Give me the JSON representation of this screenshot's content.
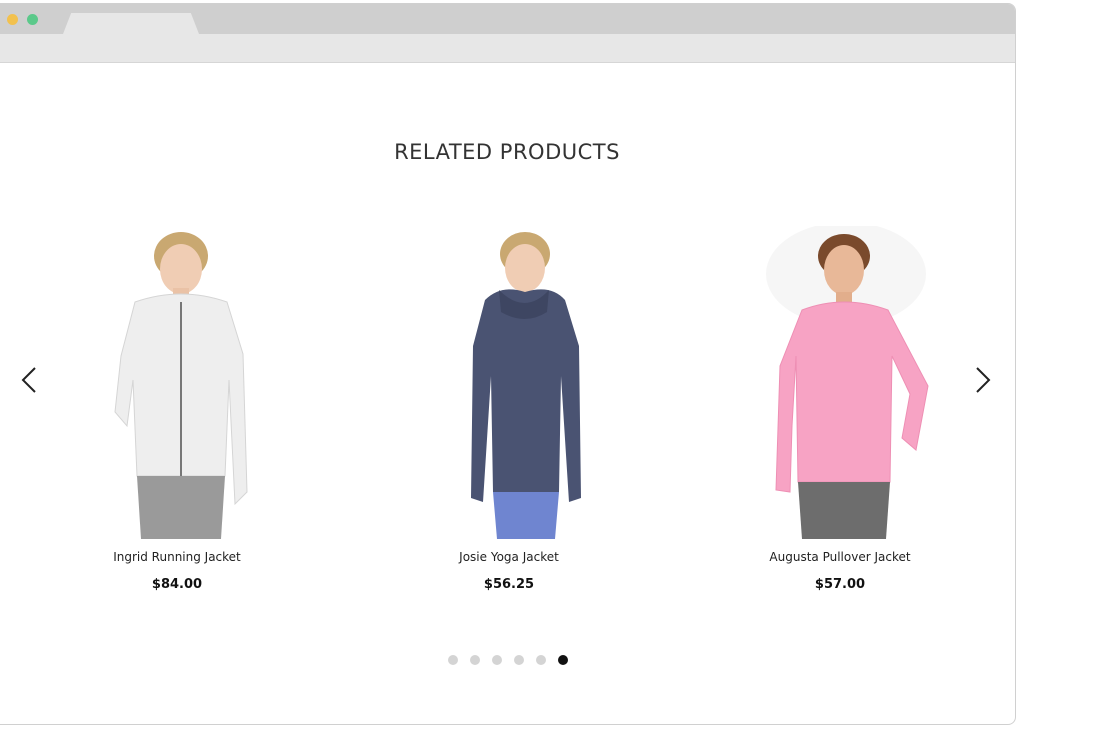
{
  "section": {
    "title": "RELATED PRODUCTS"
  },
  "products": [
    {
      "name": "Ingrid Running Jacket",
      "price": "$84.00",
      "jacket_color": "#eeeeee",
      "pants_color": "#9a9a9a"
    },
    {
      "name": "Josie Yoga Jacket",
      "price": "$56.25",
      "jacket_color": "#4a5372",
      "pants_color": "#6f85d0"
    },
    {
      "name": "Augusta Pullover Jacket",
      "price": "$57.00",
      "jacket_color": "#f7a3c4",
      "pants_color": "#6d6d6d"
    }
  ],
  "carousel": {
    "prev_icon": "chevron-left-icon",
    "next_icon": "chevron-right-icon",
    "page_count": 6,
    "active_page": 6
  },
  "colors": {
    "title": "#333333",
    "dot_inactive": "#d4d4d4",
    "dot_active": "#111111"
  }
}
